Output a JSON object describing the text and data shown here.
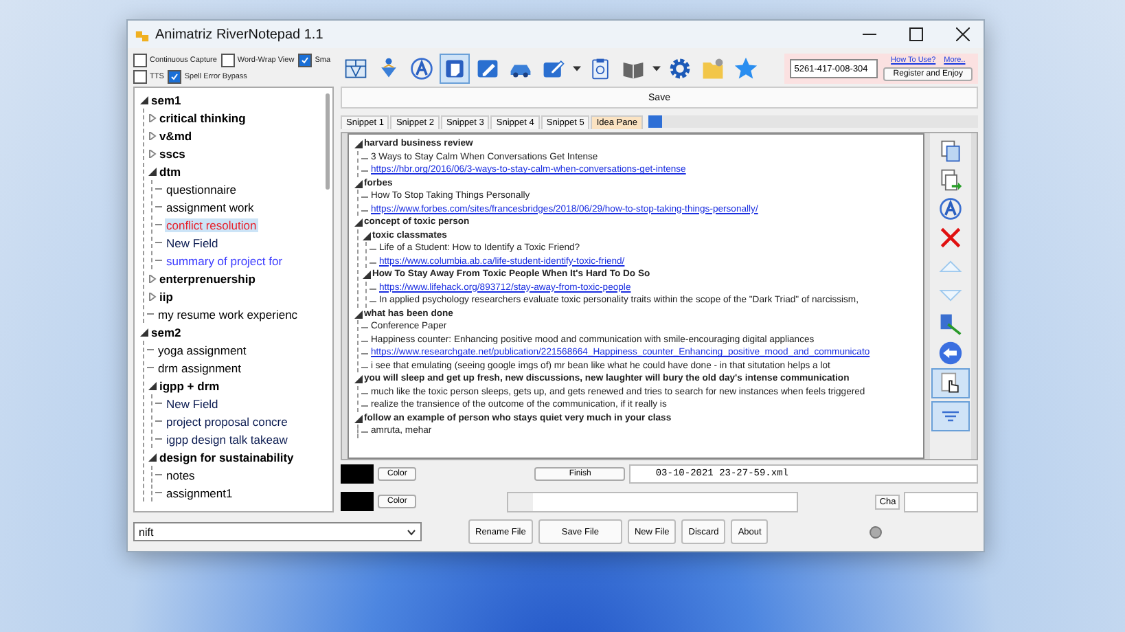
{
  "window": {
    "title": "Animatriz RiverNotepad 1.1"
  },
  "options_row_1": [
    {
      "label": "Continuous Capture",
      "checked": false
    },
    {
      "label": "Word-Wrap View",
      "checked": false
    },
    {
      "label": "Sma",
      "checked": true
    }
  ],
  "options_row_2": [
    {
      "label": "TTS",
      "checked": false
    },
    {
      "label": "Spell Error Bypass",
      "checked": true
    }
  ],
  "toolbar": [
    {
      "kind": "grid",
      "selected": false
    },
    {
      "kind": "figure",
      "selected": false
    },
    {
      "kind": "font",
      "selected": false
    },
    {
      "kind": "note",
      "selected": true
    },
    {
      "kind": "pen",
      "selected": false
    },
    {
      "kind": "car",
      "selected": false
    },
    {
      "kind": "marker",
      "selected": false
    },
    {
      "kind": "caret",
      "selected": false
    },
    {
      "kind": "clipboard",
      "selected": false
    },
    {
      "kind": "book",
      "selected": false
    },
    {
      "kind": "caret",
      "selected": false
    },
    {
      "kind": "gear",
      "selected": false
    },
    {
      "kind": "folder",
      "selected": false
    },
    {
      "kind": "star",
      "selected": false
    }
  ],
  "registration": {
    "key": "5261-417-008-304",
    "links": [
      "How To Use?",
      "More.."
    ],
    "button": "Register and Enjoy"
  },
  "tree": [
    {
      "label": "sem1",
      "expanded": true,
      "selected": false,
      "color": "#000000",
      "children": [
        {
          "label": "critical thinking",
          "expanded": false,
          "selected": false,
          "color": "#000000"
        },
        {
          "label": "v&md",
          "expanded": false,
          "selected": false,
          "color": "#000000"
        },
        {
          "label": "sscs",
          "expanded": false,
          "selected": false,
          "color": "#000000"
        },
        {
          "label": "dtm",
          "expanded": true,
          "selected": false,
          "color": "#000000",
          "children": [
            {
              "label": "questionnaire",
              "selected": false,
              "color": "#000000"
            },
            {
              "label": "assignment work",
              "selected": false,
              "color": "#000000"
            },
            {
              "label": "conflict resolution",
              "selected": true,
              "color": "#e8202a"
            },
            {
              "label": "New Field",
              "selected": false,
              "color": "#0a1a50"
            },
            {
              "label": "summary of project for",
              "selected": false,
              "color": "#3a3aff"
            }
          ]
        },
        {
          "label": "enterprenuership",
          "expanded": false,
          "selected": false,
          "color": "#000000"
        },
        {
          "label": "iip",
          "expanded": false,
          "selected": false,
          "color": "#000000"
        },
        {
          "label": "my resume work experienc",
          "selected": false,
          "color": "#000000"
        }
      ]
    },
    {
      "label": "sem2",
      "expanded": true,
      "selected": false,
      "color": "#000000",
      "children": [
        {
          "label": "yoga assignment",
          "selected": false,
          "color": "#000000"
        },
        {
          "label": "drm assignment",
          "selected": false,
          "color": "#000000"
        },
        {
          "label": "igpp + drm",
          "expanded": true,
          "selected": false,
          "color": "#000000",
          "children": [
            {
              "label": "New Field",
              "selected": false,
              "color": "#0a1a50"
            },
            {
              "label": "project proposal concre",
              "selected": false,
              "color": "#0a1a50"
            },
            {
              "label": "igpp design talk takeaw",
              "selected": false,
              "color": "#0a1a50"
            }
          ]
        },
        {
          "label": "design for sustainability",
          "expanded": true,
          "selected": false,
          "color": "#000000",
          "children": [
            {
              "label": "notes",
              "selected": false,
              "color": "#000000"
            },
            {
              "label": "assignment1",
              "selected": false,
              "color": "#000000"
            }
          ]
        }
      ]
    }
  ],
  "save_button": "Save",
  "tabs": [
    {
      "label": "Snippet 1",
      "selected": false
    },
    {
      "label": "Snippet 2",
      "selected": false
    },
    {
      "label": "Snippet 3",
      "selected": false
    },
    {
      "label": "Snippet 4",
      "selected": false
    },
    {
      "label": "Snippet 5",
      "selected": false
    },
    {
      "label": "Idea Pane",
      "selected": true
    }
  ],
  "tab_progress": {
    "level": 0.04
  },
  "editor": {
    "items": [
      {
        "kind": "heading",
        "text": "harvard business review",
        "expanded": true,
        "children": [
          {
            "kind": "text",
            "text": "3 Ways to Stay Calm When Conversations Get Intense"
          },
          {
            "kind": "link",
            "text": "https://hbr.org/2016/06/3-ways-to-stay-calm-when-conversations-get-intense"
          }
        ]
      },
      {
        "kind": "heading",
        "text": "forbes",
        "expanded": true,
        "children": [
          {
            "kind": "text",
            "text": "How To Stop Taking Things Personally"
          },
          {
            "kind": "link",
            "text": "https://www.forbes.com/sites/francesbridges/2018/06/29/how-to-stop-taking-things-personally/"
          }
        ]
      },
      {
        "kind": "heading",
        "text": "concept of toxic person",
        "expanded": true,
        "children": [
          {
            "kind": "heading",
            "text": "toxic classmates",
            "expanded": true,
            "children": [
              {
                "kind": "text",
                "text": "Life of a Student: How to Identify a Toxic Friend?"
              },
              {
                "kind": "link",
                "text": "https://www.columbia.ab.ca/life-student-identify-toxic-friend/"
              }
            ]
          },
          {
            "kind": "heading",
            "text": "How To Stay Away From Toxic People When It's Hard To Do So",
            "expanded": true,
            "children": [
              {
                "kind": "link",
                "text": "https://www.lifehack.org/893712/stay-away-from-toxic-people"
              },
              {
                "kind": "text",
                "text": "In applied psychology researchers evaluate toxic personality traits within the scope of the \"Dark Triad\" of narcissism,"
              }
            ]
          }
        ]
      },
      {
        "kind": "heading",
        "text": "what has been done",
        "expanded": true,
        "children": [
          {
            "kind": "text",
            "text": "Conference Paper"
          },
          {
            "kind": "text",
            "text": "Happiness counter: Enhancing positive mood and communication with smile-encouraging digital appliances"
          },
          {
            "kind": "link",
            "text": "https://www.researchgate.net/publication/221568664_Happiness_counter_Enhancing_positive_mood_and_communicato"
          },
          {
            "kind": "text",
            "text": "i see that emulating (seeing google imgs of) mr bean like what he could have done - in that situtation helps a lot"
          }
        ]
      },
      {
        "kind": "heading",
        "text": "you will sleep and get up fresh, new discussions, new laughter will bury the old day's intense communication",
        "expanded": true,
        "children": [
          {
            "kind": "text",
            "text": "much like the toxic person sleeps, gets up, and gets renewed and tries to search for new instances when feels triggered"
          },
          {
            "kind": "text",
            "text": "realize the transience of the outcome of the communication, if it really is"
          }
        ]
      },
      {
        "kind": "heading",
        "text": "follow an example of person who stays quiet very much in your class",
        "expanded": true,
        "children": [
          {
            "kind": "text",
            "text": "amruta, mehar"
          }
        ]
      }
    ]
  },
  "side_toolbar": [
    {
      "kind": "copy",
      "selected": false
    },
    {
      "kind": "copy-arrow",
      "selected": false
    },
    {
      "kind": "font",
      "selected": false
    },
    {
      "kind": "cross",
      "selected": false
    },
    {
      "kind": "up",
      "selected": false
    },
    {
      "kind": "down",
      "selected": false
    },
    {
      "kind": "wand",
      "selected": false
    },
    {
      "kind": "back",
      "selected": false
    },
    {
      "kind": "hand",
      "selected": true
    },
    {
      "kind": "filter",
      "selected": true
    }
  ],
  "snippet_bar": {
    "color_button": "Color",
    "finish_button": "Finish",
    "file_name": "03-10-2021 23-27-59.xml"
  },
  "format_bar": {
    "color_button": "Color",
    "char_label": "Cha"
  },
  "file_select": {
    "value": "nift"
  },
  "buttons": [
    "Rename File",
    "Save File",
    "New File",
    "Discard",
    "About"
  ]
}
